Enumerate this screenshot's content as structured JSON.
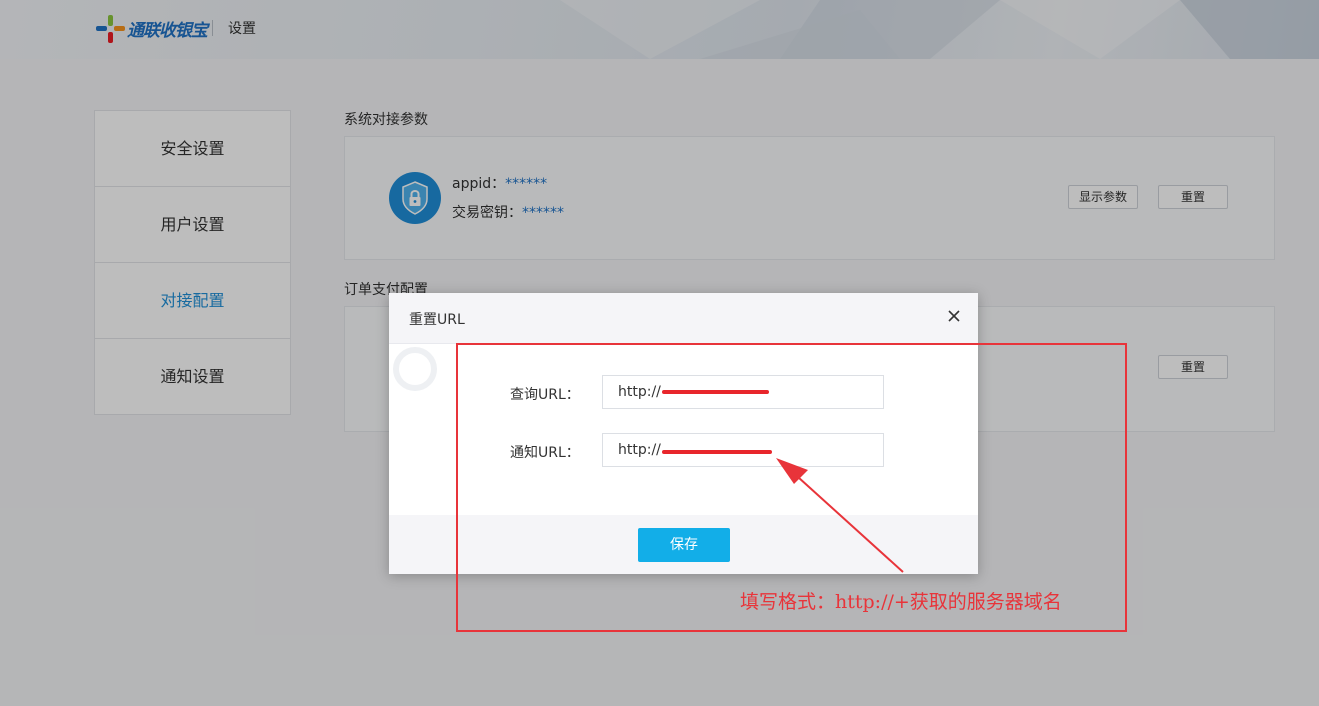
{
  "header": {
    "brand": "通联收银宝",
    "page_title": "设置",
    "colors": {
      "brand_blue": "#1f72c5"
    }
  },
  "sidebar": {
    "items": [
      {
        "label": "安全设置",
        "active": false
      },
      {
        "label": "用户设置",
        "active": false
      },
      {
        "label": "对接配置",
        "active": true
      },
      {
        "label": "通知设置",
        "active": false
      }
    ],
    "active_color": "#1f90d8"
  },
  "main": {
    "system_section": {
      "title": "系统对接参数",
      "icon": "shield-lock-icon",
      "appid_label": "appid：",
      "appid_value": "******",
      "key_label": "交易密钥：",
      "key_value": "******",
      "show_button": "显示参数",
      "reset_button": "重置"
    },
    "order_section": {
      "title": "订单支付配置",
      "reset_button": "重置"
    }
  },
  "modal": {
    "title": "重置URL",
    "close_icon": "close-icon",
    "query_label": "查询URL：",
    "query_value": "http://",
    "notify_label": "通知URL：",
    "notify_value": "http://",
    "save_button": "保存",
    "save_color": "#12aee8"
  },
  "annotation": {
    "text": "填写格式：http://+获取的服务器域名",
    "color": "#e8343a"
  }
}
